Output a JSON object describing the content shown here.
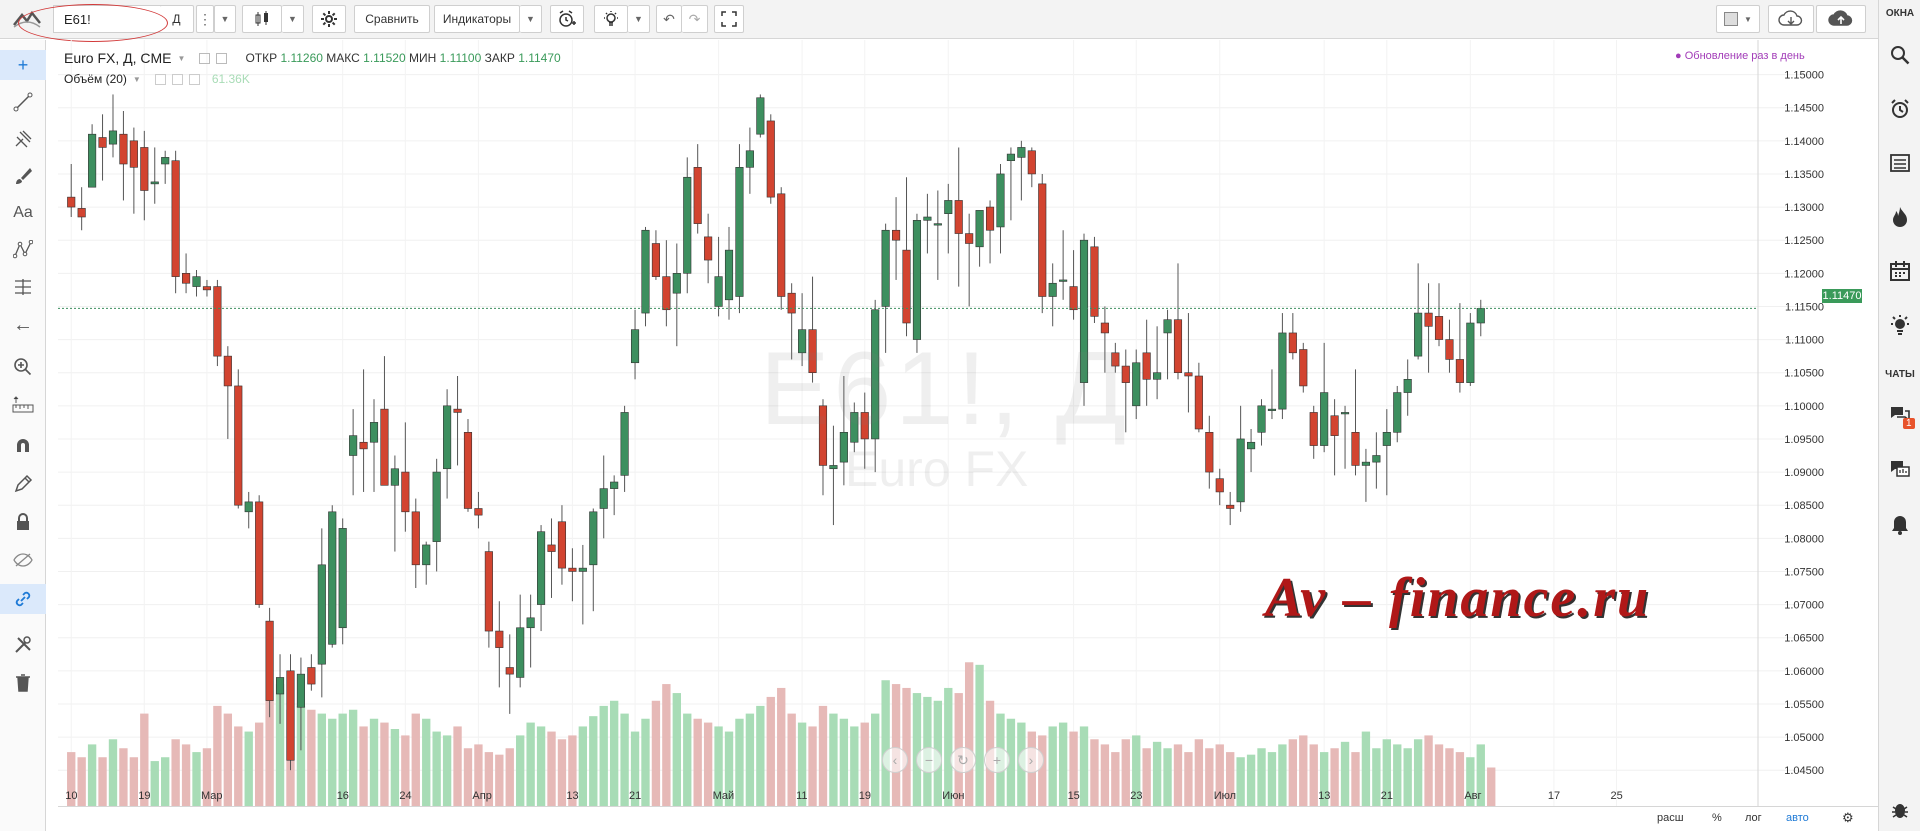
{
  "toolbar": {
    "symbol": "E61!",
    "interval": "Д",
    "compare_label": "Сравнить",
    "indicators_label": "Индикаторы"
  },
  "rightbar": {
    "windows_label": "ОКНА",
    "chats_label": "ЧАТЫ",
    "chat_badge": "1"
  },
  "legend": {
    "title": "Euro FX, Д, CME",
    "open_label": "ОТКР",
    "open": "1.11260",
    "high_label": "МАКС",
    "high": "1.11520",
    "low_label": "МИН",
    "low": "1.11100",
    "close_label": "ЗАКР",
    "close": "1.11470",
    "volume_label": "Объём (20)",
    "volume_value": "61.36K",
    "update_note": "Обновление раз в день"
  },
  "watermark": {
    "symbol": "E61!, Д",
    "name": "Euro FX"
  },
  "logo_text": "Av – finance.ru",
  "bottom": {
    "range_label": "расш",
    "percent_label": "%",
    "log_label": "лог",
    "auto_label": "авто"
  },
  "colors": {
    "up": "#3d8f5f",
    "down": "#d24430",
    "vol_up": "#a8dcb6",
    "vol_down": "#e6b9b7"
  },
  "chart_data": {
    "type": "candlestick",
    "title": "Euro FX, Д, CME",
    "ylim": [
      1.0405,
      1.1525
    ],
    "y_ticks": [
      "1.15000",
      "1.14500",
      "1.14000",
      "1.13500",
      "1.13000",
      "1.12500",
      "1.12000",
      "1.11500",
      "1.11000",
      "1.10500",
      "1.10000",
      "1.09500",
      "1.09000",
      "1.08500",
      "1.08000",
      "1.07500",
      "1.07000",
      "1.06500",
      "1.06000",
      "1.05500",
      "1.05000",
      "1.04500"
    ],
    "x_ticks": [
      "10",
      "19",
      "Мар",
      "16",
      "24",
      "Апр",
      "13",
      "21",
      "Май",
      "11",
      "19",
      "Июн",
      "15",
      "23",
      "Июл",
      "13",
      "21",
      "Авг",
      "17",
      "25"
    ],
    "current_price": "1.11470",
    "candles": [
      [
        1.1315,
        1.1365,
        1.1285,
        1.13
      ],
      [
        1.1298,
        1.133,
        1.1265,
        1.1285
      ],
      [
        1.133,
        1.1425,
        1.133,
        1.141
      ],
      [
        1.1405,
        1.144,
        1.134,
        1.139
      ],
      [
        1.1395,
        1.147,
        1.1375,
        1.1415
      ],
      [
        1.141,
        1.1445,
        1.131,
        1.1365
      ],
      [
        1.14,
        1.142,
        1.129,
        1.136
      ],
      [
        1.139,
        1.1415,
        1.128,
        1.1325
      ],
      [
        1.1335,
        1.139,
        1.1305,
        1.1338
      ],
      [
        1.1365,
        1.1385,
        1.1335,
        1.1375
      ],
      [
        1.137,
        1.1385,
        1.117,
        1.1195
      ],
      [
        1.12,
        1.123,
        1.117,
        1.1185
      ],
      [
        1.118,
        1.1205,
        1.1165,
        1.1195
      ],
      [
        1.118,
        1.119,
        1.1165,
        1.1175
      ],
      [
        1.118,
        1.119,
        1.106,
        1.1075
      ],
      [
        1.1075,
        1.109,
        1.095,
        1.103
      ],
      [
        1.103,
        1.1055,
        1.0845,
        1.085
      ],
      [
        1.084,
        1.087,
        1.0815,
        1.0855
      ],
      [
        1.0855,
        1.0865,
        1.0695,
        1.07
      ],
      [
        1.0675,
        1.0695,
        1.053,
        1.0555
      ],
      [
        1.0565,
        1.0625,
        1.052,
        1.059
      ],
      [
        1.06,
        1.0625,
        1.045,
        1.0465
      ],
      [
        1.0545,
        1.062,
        1.048,
        1.0595
      ],
      [
        1.0605,
        1.0625,
        1.057,
        1.058
      ],
      [
        1.061,
        1.0815,
        1.056,
        1.076
      ],
      [
        1.064,
        1.085,
        1.0635,
        1.084
      ],
      [
        1.0665,
        1.083,
        1.064,
        1.0815
      ],
      [
        1.0925,
        1.0995,
        1.0865,
        1.0955
      ],
      [
        1.0945,
        1.1055,
        1.087,
        1.0935
      ],
      [
        1.0945,
        1.101,
        1.087,
        1.0975
      ],
      [
        1.0995,
        1.1075,
        1.0895,
        1.088
      ],
      [
        1.088,
        1.0925,
        1.078,
        1.0905
      ],
      [
        1.09,
        1.0975,
        1.081,
        1.084
      ],
      [
        1.084,
        1.086,
        1.0725,
        1.076
      ],
      [
        1.076,
        1.0795,
        1.073,
        1.079
      ],
      [
        1.0795,
        1.092,
        1.075,
        1.09
      ],
      [
        1.0905,
        1.1025,
        1.086,
        1.1
      ],
      [
        1.0995,
        1.1045,
        1.091,
        1.099
      ],
      [
        1.096,
        1.098,
        1.084,
        1.0845
      ],
      [
        1.0845,
        1.087,
        1.0815,
        1.0835
      ],
      [
        1.078,
        1.0795,
        1.0635,
        1.066
      ],
      [
        1.066,
        1.0705,
        1.0575,
        1.0635
      ],
      [
        1.0605,
        1.0655,
        1.0535,
        1.0595
      ],
      [
        1.059,
        1.0715,
        1.0575,
        1.0665
      ],
      [
        1.0665,
        1.0715,
        1.0605,
        1.068
      ],
      [
        1.07,
        1.082,
        1.066,
        1.081
      ],
      [
        1.079,
        1.083,
        1.071,
        1.078
      ],
      [
        1.0825,
        1.085,
        1.073,
        1.0755
      ],
      [
        1.0755,
        1.0785,
        1.0705,
        1.075
      ],
      [
        1.075,
        1.079,
        1.067,
        1.0755
      ],
      [
        1.076,
        1.0845,
        1.069,
        1.084
      ],
      [
        1.0845,
        1.0925,
        1.08,
        1.0875
      ],
      [
        1.0875,
        1.0895,
        1.0835,
        1.0885
      ],
      [
        1.0895,
        1.1,
        1.087,
        1.099
      ],
      [
        1.1065,
        1.1145,
        1.104,
        1.1115
      ],
      [
        1.114,
        1.127,
        1.112,
        1.1265
      ],
      [
        1.1245,
        1.1265,
        1.119,
        1.1195
      ],
      [
        1.1195,
        1.125,
        1.112,
        1.1145
      ],
      [
        1.117,
        1.1245,
        1.109,
        1.12
      ],
      [
        1.12,
        1.1375,
        1.117,
        1.1345
      ],
      [
        1.136,
        1.1395,
        1.126,
        1.1275
      ],
      [
        1.1255,
        1.129,
        1.1185,
        1.122
      ],
      [
        1.115,
        1.1255,
        1.1135,
        1.1195
      ],
      [
        1.116,
        1.127,
        1.113,
        1.1235
      ],
      [
        1.1165,
        1.1395,
        1.114,
        1.136
      ],
      [
        1.136,
        1.142,
        1.132,
        1.1385
      ],
      [
        1.141,
        1.147,
        1.1405,
        1.1465
      ],
      [
        1.143,
        1.144,
        1.1305,
        1.1315
      ],
      [
        1.132,
        1.133,
        1.1145,
        1.1165
      ],
      [
        1.117,
        1.1185,
        1.107,
        1.114
      ],
      [
        1.108,
        1.117,
        1.106,
        1.1115
      ],
      [
        1.1115,
        1.1195,
        1.1035,
        1.105
      ],
      [
        1.1,
        1.101,
        1.0865,
        1.091
      ],
      [
        1.0905,
        1.097,
        1.082,
        1.091
      ],
      [
        1.0915,
        1.1045,
        1.088,
        1.096
      ],
      [
        1.0945,
        1.1005,
        1.093,
        1.099
      ],
      [
        1.099,
        1.102,
        1.0905,
        1.095
      ],
      [
        1.095,
        1.116,
        1.09,
        1.1145
      ],
      [
        1.115,
        1.1275,
        1.108,
        1.1265
      ],
      [
        1.1265,
        1.1315,
        1.119,
        1.125
      ],
      [
        1.1235,
        1.1345,
        1.1105,
        1.1125
      ],
      [
        1.11,
        1.129,
        1.108,
        1.128
      ],
      [
        1.128,
        1.132,
        1.123,
        1.1285
      ],
      [
        1.1275,
        1.1325,
        1.119,
        1.1275
      ],
      [
        1.129,
        1.1335,
        1.123,
        1.131
      ],
      [
        1.131,
        1.139,
        1.118,
        1.126
      ],
      [
        1.126,
        1.129,
        1.115,
        1.1245
      ],
      [
        1.124,
        1.1295,
        1.121,
        1.1295
      ],
      [
        1.13,
        1.131,
        1.1215,
        1.1265
      ],
      [
        1.127,
        1.1365,
        1.123,
        1.135
      ],
      [
        1.137,
        1.139,
        1.128,
        1.138
      ],
      [
        1.1375,
        1.14,
        1.131,
        1.139
      ],
      [
        1.1385,
        1.139,
        1.133,
        1.135
      ],
      [
        1.1335,
        1.135,
        1.114,
        1.1165
      ],
      [
        1.1165,
        1.1215,
        1.112,
        1.1185
      ],
      [
        1.119,
        1.1265,
        1.116,
        1.119
      ],
      [
        1.118,
        1.1235,
        1.113,
        1.1145
      ],
      [
        1.1035,
        1.126,
        1.1,
        1.125
      ],
      [
        1.124,
        1.1255,
        1.1125,
        1.1135
      ],
      [
        1.1125,
        1.115,
        1.105,
        1.111
      ],
      [
        1.108,
        1.1095,
        1.105,
        1.106
      ],
      [
        1.106,
        1.1085,
        1.096,
        1.1035
      ],
      [
        1.1,
        1.1085,
        1.098,
        1.1065
      ],
      [
        1.108,
        1.113,
        1.1,
        1.104
      ],
      [
        1.104,
        1.112,
        1.101,
        1.105
      ],
      [
        1.111,
        1.1145,
        1.104,
        1.113
      ],
      [
        1.113,
        1.1215,
        1.104,
        1.105
      ],
      [
        1.105,
        1.114,
        1.099,
        1.1045
      ],
      [
        1.1045,
        1.1065,
        1.096,
        1.0965
      ],
      [
        1.096,
        1.0985,
        1.0875,
        1.09
      ],
      [
        1.089,
        1.0905,
        1.085,
        1.087
      ],
      [
        1.085,
        1.087,
        1.082,
        1.0845
      ],
      [
        1.0855,
        1.1,
        1.084,
        1.095
      ],
      [
        1.0935,
        1.0965,
        1.09,
        1.0945
      ],
      [
        1.096,
        1.101,
        1.094,
        1.1
      ],
      [
        1.0995,
        1.1055,
        1.098,
        1.0995
      ],
      [
        1.0995,
        1.114,
        1.098,
        1.111
      ],
      [
        1.111,
        1.114,
        1.107,
        1.108
      ],
      [
        1.1085,
        1.1095,
        1.102,
        1.103
      ],
      [
        1.099,
        1.1,
        1.092,
        1.094
      ],
      [
        1.094,
        1.1095,
        1.093,
        1.102
      ],
      [
        1.0985,
        1.101,
        1.0895,
        1.0955
      ],
      [
        1.099,
        1.1,
        1.0905,
        1.099
      ],
      [
        1.096,
        1.1055,
        1.0895,
        1.091
      ],
      [
        1.091,
        1.0935,
        1.0855,
        1.0915
      ],
      [
        1.0915,
        1.096,
        1.0875,
        1.0925
      ],
      [
        1.094,
        1.0995,
        1.0865,
        1.096
      ],
      [
        1.096,
        1.103,
        1.0945,
        1.102
      ],
      [
        1.102,
        1.107,
        1.0985,
        1.104
      ],
      [
        1.1075,
        1.1215,
        1.107,
        1.114
      ],
      [
        1.114,
        1.1185,
        1.105,
        1.112
      ],
      [
        1.1135,
        1.1185,
        1.109,
        1.11
      ],
      [
        1.11,
        1.113,
        1.105,
        1.107
      ],
      [
        1.107,
        1.1155,
        1.102,
        1.1035
      ],
      [
        1.1035,
        1.114,
        1.103,
        1.1125
      ],
      [
        1.1125,
        1.116,
        1.1105,
        1.1147
      ]
    ],
    "volume_k": [
      42,
      38,
      48,
      38,
      52,
      45,
      38,
      72,
      35,
      38,
      52,
      48,
      42,
      45,
      78,
      72,
      62,
      58,
      65,
      82,
      95,
      75,
      78,
      75,
      72,
      68,
      72,
      75,
      62,
      68,
      65,
      60,
      55,
      72,
      68,
      58,
      55,
      62,
      45,
      48,
      42,
      40,
      45,
      55,
      65,
      62,
      58,
      52,
      55,
      62,
      70,
      78,
      82,
      72,
      58,
      68,
      82,
      95,
      88,
      72,
      68,
      65,
      62,
      58,
      68,
      72,
      78,
      85,
      92,
      72,
      65,
      62,
      78,
      72,
      68,
      62,
      65,
      72,
      98,
      95,
      92,
      88,
      85,
      82,
      92,
      88,
      112,
      110,
      82,
      72,
      68,
      65,
      58,
      55,
      62,
      65,
      58,
      62,
      52,
      48,
      42,
      52,
      55,
      45,
      50,
      45,
      48,
      42,
      52,
      45,
      48,
      42,
      38,
      40,
      45,
      42,
      48,
      52,
      55,
      48,
      42,
      45,
      50,
      42,
      58,
      45,
      52,
      48,
      45,
      52,
      55,
      48,
      45,
      42,
      38,
      48,
      30
    ]
  }
}
